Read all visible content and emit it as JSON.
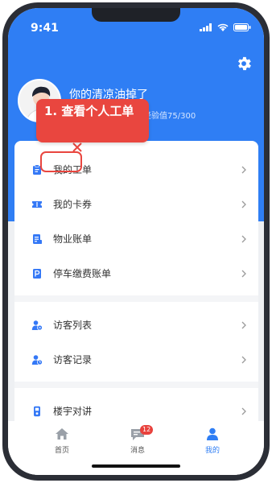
{
  "status_bar": {
    "time": "9:41"
  },
  "profile": {
    "username": "你的清凉油掉了",
    "exp_label": "经验值75/300"
  },
  "callout": {
    "text": "1. 查看个人工单"
  },
  "menu": [
    {
      "label": "我的工单",
      "icon": "ticket-icon"
    },
    {
      "label": "我的卡券",
      "icon": "coupon-icon"
    },
    {
      "label": "物业账单",
      "icon": "bill-icon"
    },
    {
      "label": "停车缴费账单",
      "icon": "parking-icon"
    },
    {
      "label": "访客列表",
      "icon": "visitor-list-icon"
    },
    {
      "label": "访客记录",
      "icon": "visitor-record-icon"
    },
    {
      "label": "楼宇对讲",
      "icon": "intercom-icon"
    }
  ],
  "tabbar": {
    "home": "首页",
    "messages": "消息",
    "messages_badge": "12",
    "mine": "我的",
    "active": "mine"
  },
  "colors": {
    "primary": "#2f7ef4",
    "accent_red": "#e9463f",
    "icon_blue": "#3478f6"
  }
}
